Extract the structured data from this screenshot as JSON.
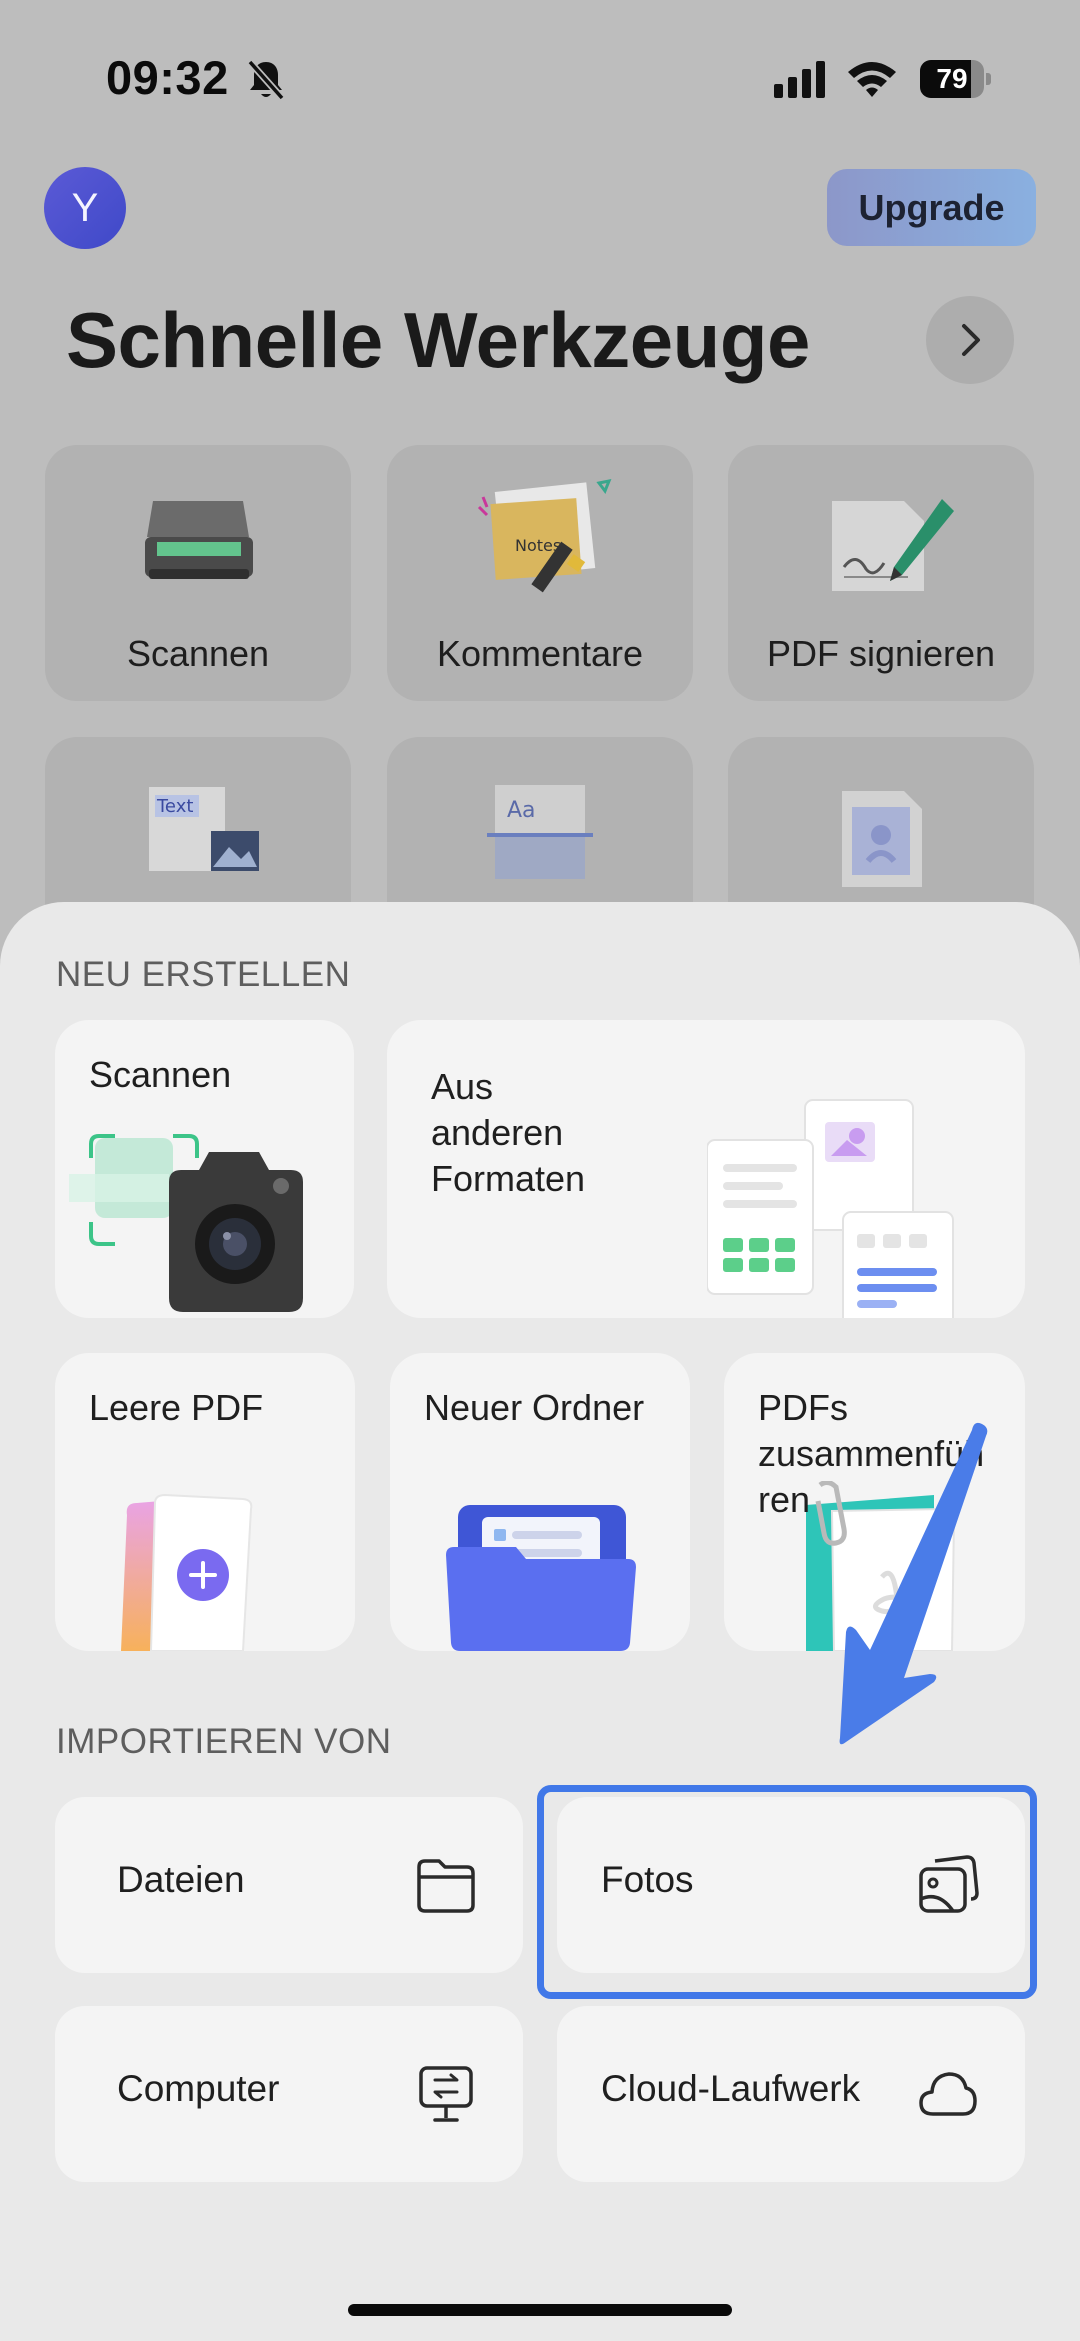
{
  "status_bar": {
    "time": "09:32",
    "battery": "79",
    "battery_level": 0.79
  },
  "header": {
    "avatar_initial": "Y",
    "upgrade_label": "Upgrade"
  },
  "quick_tools": {
    "title": "Schnelle Werkzeuge",
    "items": [
      {
        "label": "Scannen",
        "icon": "scanner-icon"
      },
      {
        "label": "Kommentare",
        "icon": "notes-icon",
        "icon_text": "Notes"
      },
      {
        "label": "PDF signieren",
        "icon": "signature-pen-icon"
      },
      {
        "label": "",
        "icon": "text-image-icon",
        "icon_text": "Text"
      },
      {
        "label": "",
        "icon": "ocr-icon",
        "icon_text": "Aa"
      },
      {
        "label": "",
        "icon": "image-file-icon"
      }
    ]
  },
  "create": {
    "heading": "NEU ERSTELLEN",
    "scan_label": "Scannen",
    "formats_label_lines": [
      "Aus",
      "anderen",
      "Formaten"
    ],
    "blank_pdf_label": "Leere PDF",
    "new_folder_label": "Neuer Ordner",
    "merge_label_lines": [
      "PDFs",
      "zusammenfüh",
      "ren"
    ]
  },
  "import": {
    "heading": "IMPORTIEREN VON",
    "items": [
      {
        "label": "Dateien",
        "icon": "folder-icon"
      },
      {
        "label": "Fotos",
        "icon": "photos-icon"
      },
      {
        "label": "Computer",
        "icon": "computer-transfer-icon"
      },
      {
        "label": "Cloud-Laufwerk",
        "icon": "cloud-icon"
      }
    ]
  },
  "annotation": {
    "color": "#4178e8",
    "target": "Fotos"
  }
}
